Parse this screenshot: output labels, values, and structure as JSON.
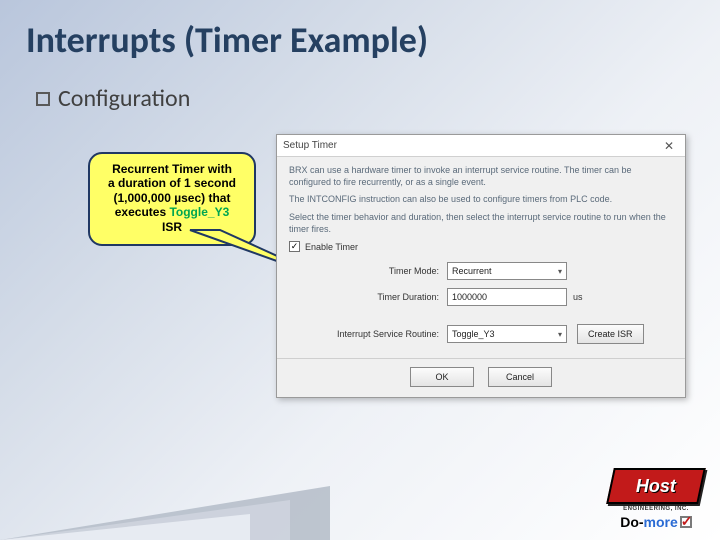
{
  "title": "Interrupts (Timer Example)",
  "bullet": "Configuration",
  "callout": {
    "l1": "Recurrent Timer with",
    "l2": "a duration of 1 second",
    "l3": "(1,000,000 µsec) that",
    "l4a": "executes ",
    "l4b": "Toggle_Y3",
    "l5": "ISR"
  },
  "dialog": {
    "title": "Setup Timer",
    "close": "✕",
    "desc1": "BRX can use a hardware timer to invoke an interrupt service routine. The timer can be configured to fire recurrently, or as a single event.",
    "desc2": "The INTCONFIG instruction can also be used to configure timers from PLC code.",
    "desc3": "Select the timer behavior and duration, then select the interrupt service routine to run when the timer fires.",
    "enable": "Enable Timer",
    "mode_label": "Timer Mode:",
    "mode_value": "Recurrent",
    "dur_label": "Timer Duration:",
    "dur_value": "1000000",
    "dur_unit": "us",
    "isr_label": "Interrupt Service Routine:",
    "isr_value": "Toggle_Y3",
    "create_isr": "Create ISR",
    "ok": "OK",
    "cancel": "Cancel"
  },
  "logos": {
    "host": "Host",
    "host_sub": "ENGINEERING, INC.",
    "domore_do": "Do-",
    "domore_more": "more"
  }
}
